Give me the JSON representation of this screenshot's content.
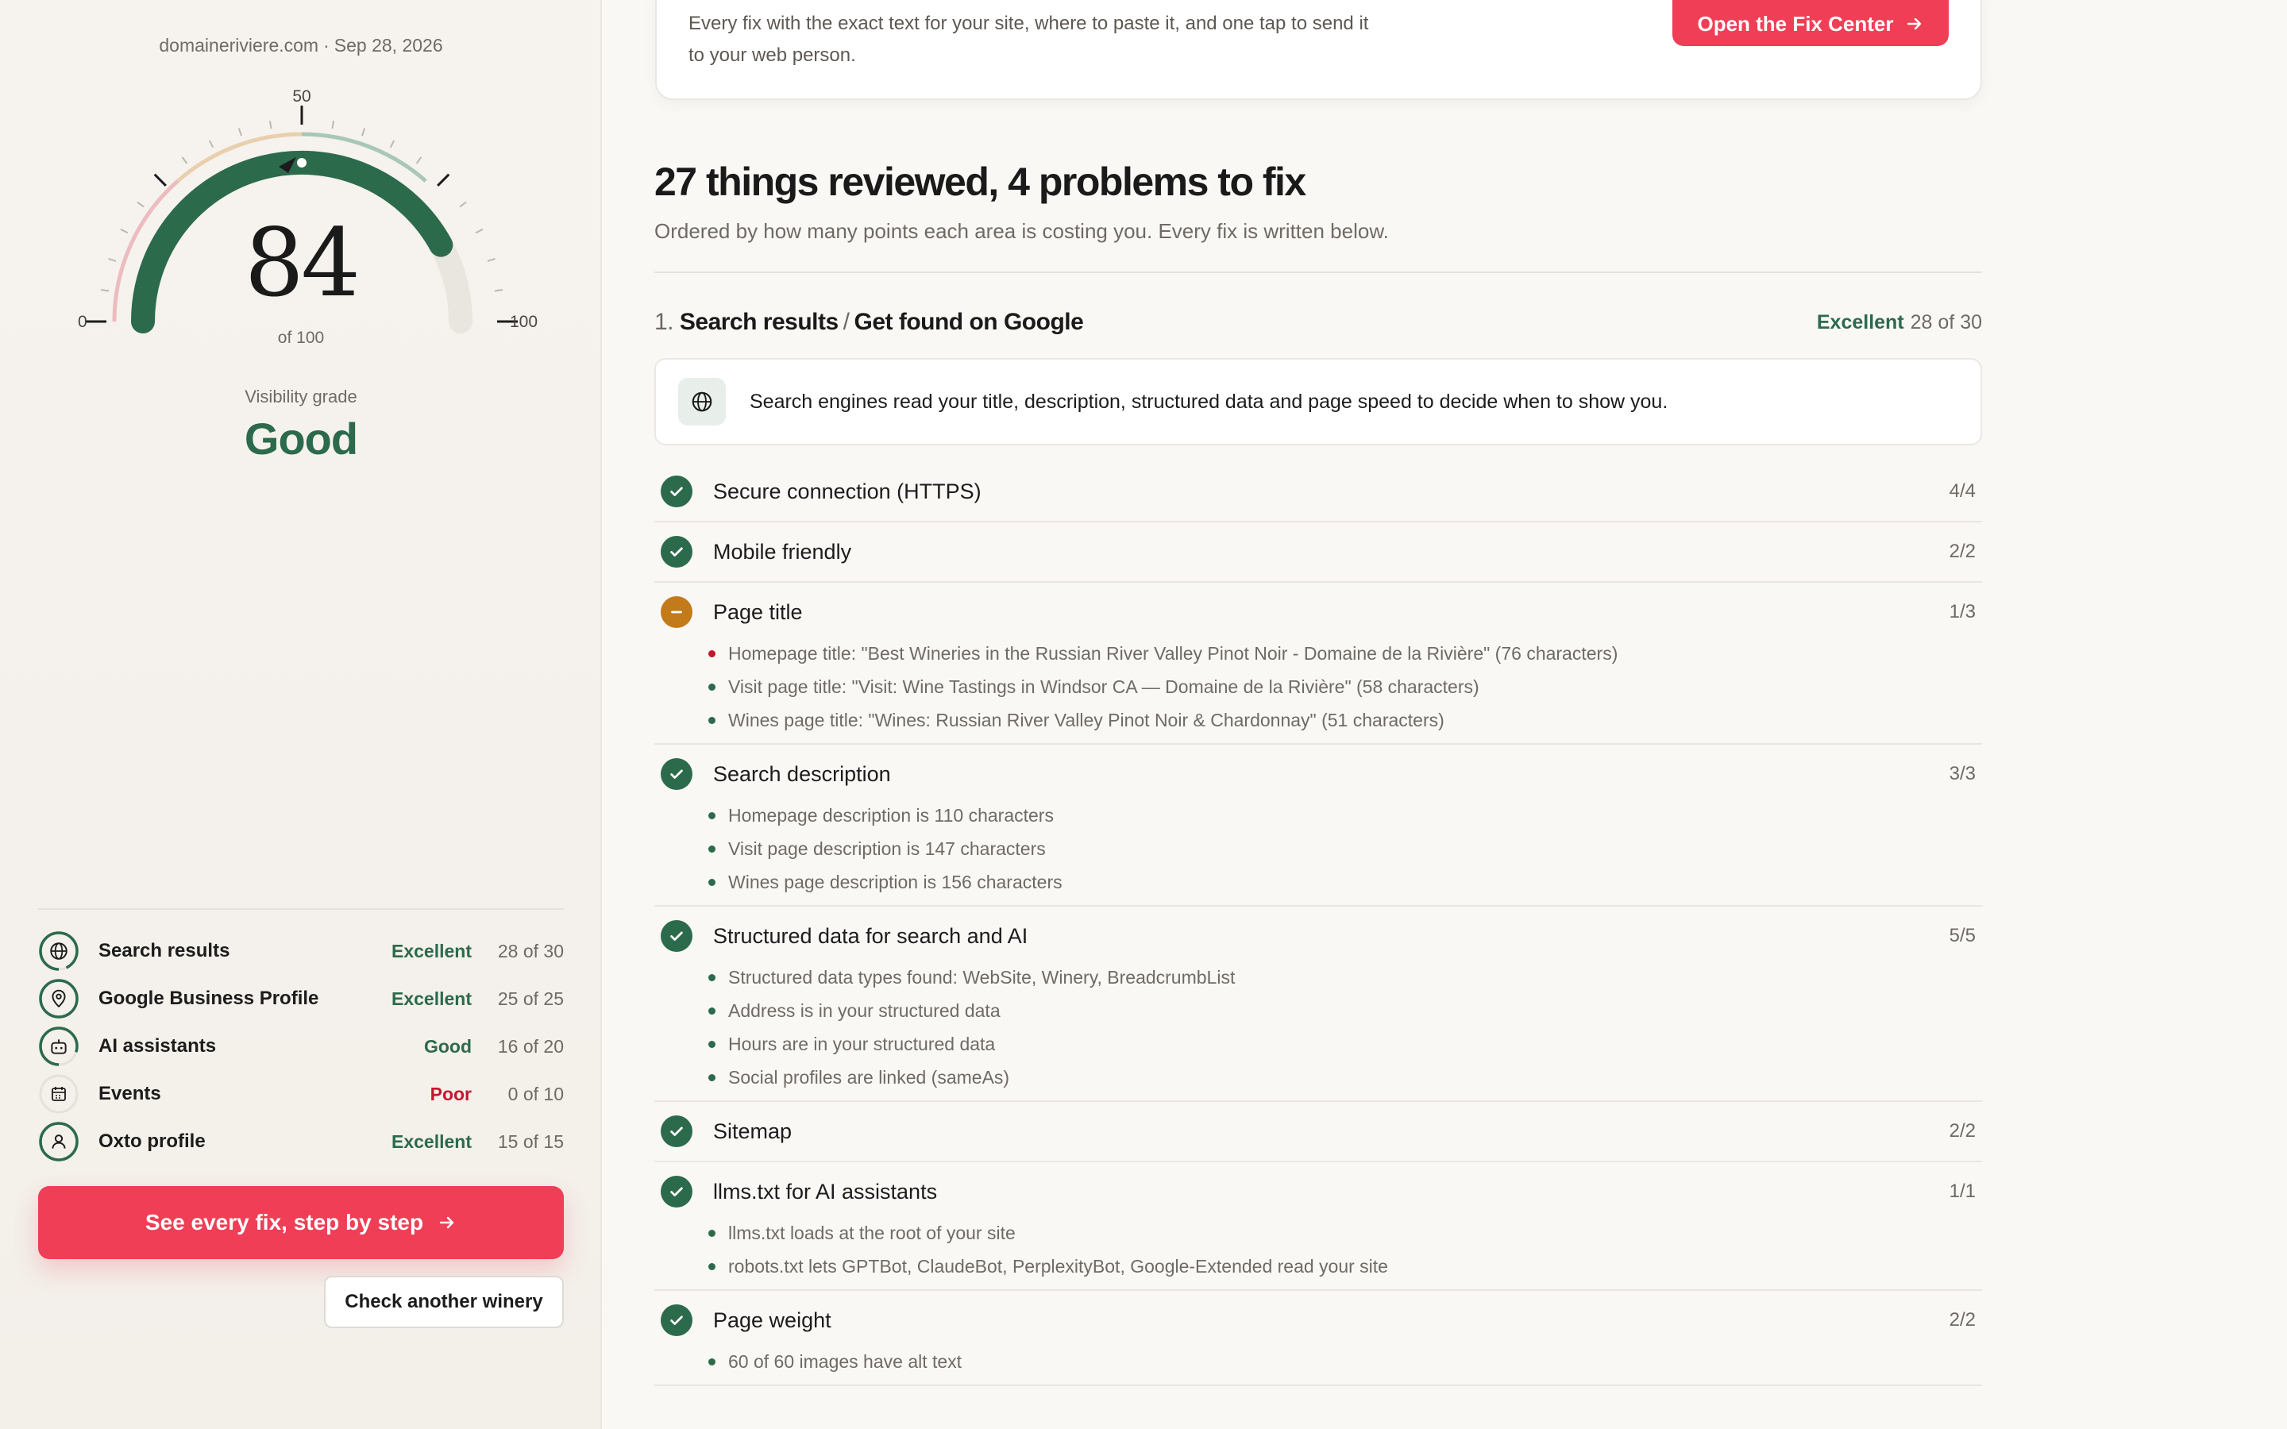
{
  "report": {
    "site": "domaineriviere.com",
    "separator": "·",
    "date": "Sep 28, 2026",
    "score": "84",
    "score_of": "of 100",
    "gauge_min": "0",
    "gauge_mid": "50",
    "gauge_max": "100",
    "score_fraction": 0.84,
    "grade_label": "Visibility grade",
    "grade": "Good"
  },
  "categories": [
    {
      "name": "Search results",
      "grade": "Excellent",
      "score": "28 of 30",
      "icon": "globe-icon",
      "fraction": 0.93
    },
    {
      "name": "Google Business Profile",
      "grade": "Excellent",
      "score": "25 of 25",
      "icon": "map-pin-icon",
      "fraction": 1.0
    },
    {
      "name": "AI assistants",
      "grade": "Good",
      "score": "16 of 20",
      "icon": "robot-icon",
      "fraction": 0.8
    },
    {
      "name": "Events",
      "grade": "Poor",
      "score": "0 of 10",
      "icon": "calendar-icon",
      "fraction": 0.0
    },
    {
      "name": "Oxto profile",
      "grade": "Excellent",
      "score": "15 of 15",
      "icon": "user-icon",
      "fraction": 1.0
    }
  ],
  "actions": {
    "primary": "See every fix, step by step",
    "secondary": "Check another winery"
  },
  "fix_center": {
    "text": "Every fix with the exact text for your site, where to paste it, and one tap to send it to your web person.",
    "button": "Open the Fix Center"
  },
  "summary": {
    "headline": "27 things reviewed, 4 problems to fix",
    "subhead": "Ordered by how many points each area is costing you. Every fix is written below."
  },
  "section": {
    "number": "1.",
    "title_a": "Search results",
    "slash": "/",
    "title_b": "Get found on Google",
    "grade": "Excellent",
    "score": "28 of 30",
    "info": "Search engines read your title, description, structured data and page speed to decide when to show you."
  },
  "checks": [
    {
      "name": "Secure connection (HTTPS)",
      "score": "4/4",
      "status": "pass",
      "details": []
    },
    {
      "name": "Mobile friendly",
      "score": "2/2",
      "status": "pass",
      "details": []
    },
    {
      "name": "Page title",
      "score": "1/3",
      "status": "warn",
      "details": [
        {
          "text": "Homepage title: \"Best Wineries in the Russian River Valley Pinot Noir - Domaine de la Rivière\" (76 characters)",
          "bad": true
        },
        {
          "text": "Visit page title: \"Visit: Wine Tastings in Windsor CA — Domaine de la Rivière\" (58 characters)",
          "bad": false
        },
        {
          "text": "Wines page title: \"Wines: Russian River Valley Pinot Noir & Chardonnay\" (51 characters)",
          "bad": false
        }
      ]
    },
    {
      "name": "Search description",
      "score": "3/3",
      "status": "pass",
      "details": [
        {
          "text": "Homepage description is 110 characters",
          "bad": false
        },
        {
          "text": "Visit page description is 147 characters",
          "bad": false
        },
        {
          "text": "Wines page description is 156 characters",
          "bad": false
        }
      ]
    },
    {
      "name": "Structured data for search and AI",
      "score": "5/5",
      "status": "pass",
      "details": [
        {
          "text": "Structured data types found: WebSite, Winery, BreadcrumbList",
          "bad": false
        },
        {
          "text": "Address is in your structured data",
          "bad": false
        },
        {
          "text": "Hours are in your structured data",
          "bad": false
        },
        {
          "text": "Social profiles are linked (sameAs)",
          "bad": false
        }
      ]
    },
    {
      "name": "Sitemap",
      "score": "2/2",
      "status": "pass",
      "details": []
    },
    {
      "name": "llms.txt for AI assistants",
      "score": "1/1",
      "status": "pass",
      "details": [
        {
          "text": "llms.txt loads at the root of your site",
          "bad": false
        },
        {
          "text": "robots.txt lets GPTBot, ClaudeBot, PerplexityBot, Google-Extended read your site",
          "bad": false
        }
      ]
    },
    {
      "name": "Page weight",
      "score": "2/2",
      "status": "pass",
      "details": [
        {
          "text": "60 of 60 images have alt text",
          "bad": false
        }
      ]
    }
  ],
  "colors": {
    "accent": "#ef3e55",
    "brand_green": "#2c6a4c",
    "warning": "#c27a1a",
    "poor": "#c2182e",
    "background": "#faf8f5"
  }
}
